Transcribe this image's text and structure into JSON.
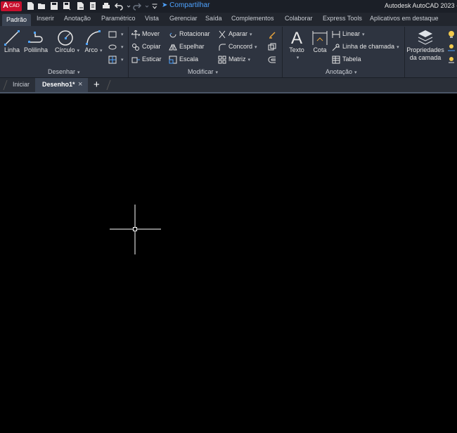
{
  "app": {
    "logo_text": "A",
    "logo_sub": "CAD",
    "title": "Autodesk AutoCAD 2023 -",
    "share_label": "Compartilhar"
  },
  "ribbon_tabs": [
    "Padrão",
    "Inserir",
    "Anotação",
    "Paramétrico",
    "Vista",
    "Gerenciar",
    "Saída",
    "Complementos",
    "Colaborar",
    "Express Tools",
    "Aplicativos em destaque"
  ],
  "draw_panel": {
    "label": "Desenhar",
    "line": "Linha",
    "polyline": "Polilinha",
    "circle": "Círculo",
    "arc": "Arco"
  },
  "modify_panel": {
    "label": "Modificar",
    "move": "Mover",
    "rotate": "Rotacionar",
    "trim": "Aparar",
    "copy": "Copiar",
    "mirror": "Espelhar",
    "fillet": "Concord",
    "stretch": "Esticar",
    "scale": "Escala",
    "array": "Matriz"
  },
  "annotation_panel": {
    "label": "Anotação",
    "text": "Texto",
    "dimension": "Cota",
    "linear": "Linear",
    "leader": "Linha de chamada",
    "table": "Tabela"
  },
  "layers_panel": {
    "properties_line1": "Propriedades",
    "properties_line2": "da camada"
  },
  "doc_tabs": {
    "start": "Iniciar",
    "drawing": "Desenho1*",
    "close": "×",
    "add": "+"
  },
  "colors": {
    "accent": "#4fa3ff",
    "logo": "#c8102e",
    "ribbon_bg": "#2e3440",
    "canvas_bg": "#000000"
  }
}
